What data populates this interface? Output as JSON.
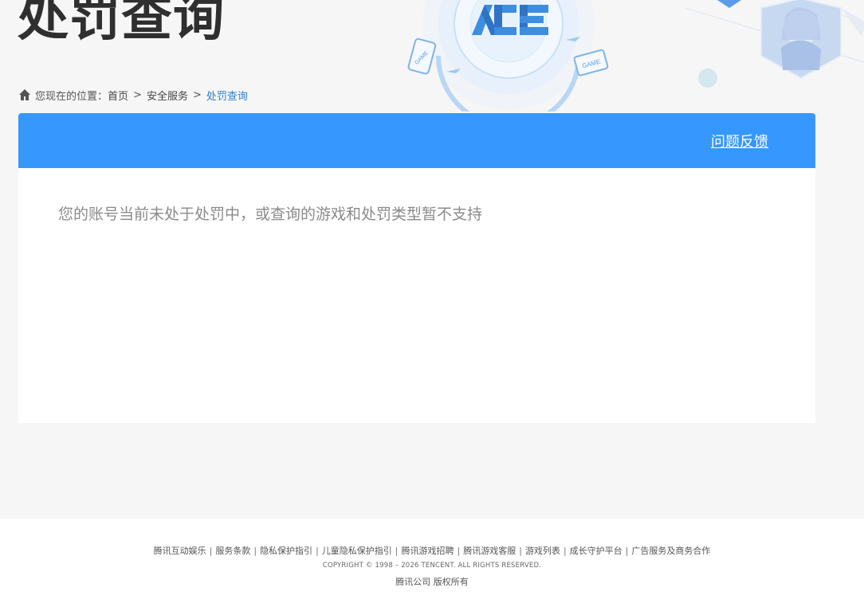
{
  "hero": {
    "title": "处罚查询",
    "logo_text": "ACE",
    "badge_text_1": "GAME",
    "badge_text_2": "GAME"
  },
  "breadcrumb": {
    "prefix": "您现在的位置：",
    "items": [
      {
        "label": "首页"
      },
      {
        "label": "安全服务"
      },
      {
        "label": "处罚查询"
      }
    ],
    "separator": ">"
  },
  "panel": {
    "feedback_label": "问题反馈",
    "message": "您的账号当前未处于处罚中，或查询的游戏和处罚类型暂不支持"
  },
  "footer": {
    "links": [
      {
        "label": "腾讯互动娱乐"
      },
      {
        "label": "服务条款"
      },
      {
        "label": "隐私保护指引"
      },
      {
        "label": "儿童隐私保护指引"
      },
      {
        "label": "腾讯游戏招聘"
      },
      {
        "label": "腾讯游戏客服"
      },
      {
        "label": "游戏列表"
      },
      {
        "label": "成长守护平台"
      },
      {
        "label": "广告服务及商务合作"
      }
    ],
    "divider": "|",
    "copyright": "COPYRIGHT © 1998 – 2026 TENCENT. ALL RIGHTS RESERVED.",
    "company": "腾讯公司 版权所有"
  },
  "colors": {
    "accent": "#3697ff",
    "link_current": "#2b7fd6",
    "title": "#2f2f2f"
  },
  "icons": {
    "home": "home-icon"
  }
}
